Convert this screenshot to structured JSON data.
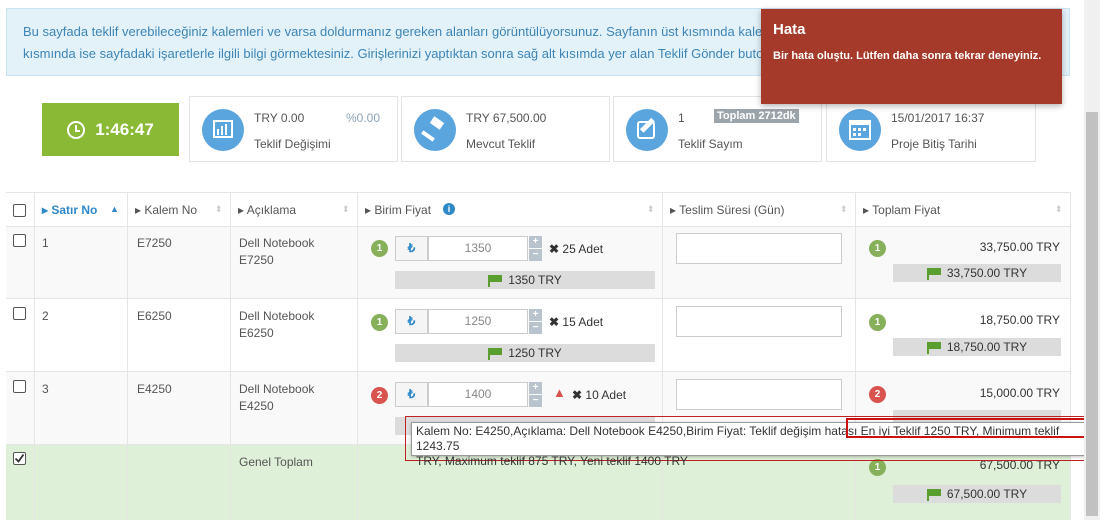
{
  "info_text": "Bu sayfada teklif verebileceğiniz kalemleri ve varsa doldurmanız gereken alanları görüntülüyorsunuz. Sayfanın üst kısmında kalemle ilgili detay bilgileri ve süreç saatini, sol alt kısmında ise sayfadaki işaretlerle ilgili bilgi görmektesiniz. Girişlerinizi yaptıktan sonra sağ alt kısımda yer alan Teklif Gönder butonuna basınız.",
  "timer": "1:46:47",
  "stats": [
    {
      "value": "TRY 0.00",
      "extra": "%0.00",
      "label": "Teklif Değişimi",
      "icon": "chart-icon"
    },
    {
      "value": "TRY 67,500.00",
      "label": "Mevcut Teklif",
      "icon": "gavel-icon"
    },
    {
      "value": "1",
      "extra": "Toplam 2712dk",
      "label": "Teklif Sayım",
      "icon": "edit-icon"
    },
    {
      "value": "15/01/2017 16:37",
      "label": "Proje Bitiş Tarihi",
      "icon": "calendar-icon"
    }
  ],
  "toast": {
    "title": "Hata",
    "message": "Bir hata oluştu. Lütfen daha sonra tekrar deneyiniz."
  },
  "columns": [
    "Satır No",
    "Kalem No",
    "Açıklama",
    "Birim Fiyat",
    "Teslim Süresi (Gün)",
    "Toplam Fiyat"
  ],
  "rows": [
    {
      "no": "1",
      "kalem": "E7250",
      "aciklama": "Dell Notebook E7250",
      "rank": "1",
      "price": "1350",
      "qty": "25 Adet",
      "best": "1350 TRY",
      "total": "33,750.00 TRY",
      "total_rank": "1",
      "total_best": "33,750.00 TRY"
    },
    {
      "no": "2",
      "kalem": "E6250",
      "aciklama": "Dell Notebook E6250",
      "rank": "1",
      "price": "1250",
      "qty": "15 Adet",
      "best": "1250 TRY",
      "total": "18,750.00 TRY",
      "total_rank": "1",
      "total_best": "18,750.00 TRY"
    },
    {
      "no": "3",
      "kalem": "E4250",
      "aciklama": "Dell Notebook E4250",
      "rank": "2",
      "price": "1400",
      "qty": "10 Adet",
      "best": "",
      "total": "15,000.00 TRY",
      "total_rank": "2",
      "total_best": ""
    }
  ],
  "footer": {
    "label": "Genel Toplam",
    "total": "67,500.00 TRY",
    "rank": "1",
    "best": "67,500.00 TRY"
  },
  "tooltip": {
    "text_a": "Kalem No: E4250,Açıklama: Dell Notebook E4250,Birim Fiyat: Teklif değişim hatası",
    "text_b": "En iyi Teklif 1250 TRY, Minimum teklif 1243.75",
    "text_c": "TRY, Maximum teklif 875 TRY, Yeni teklif 1400 TRY"
  },
  "currency_symbol": "₺"
}
